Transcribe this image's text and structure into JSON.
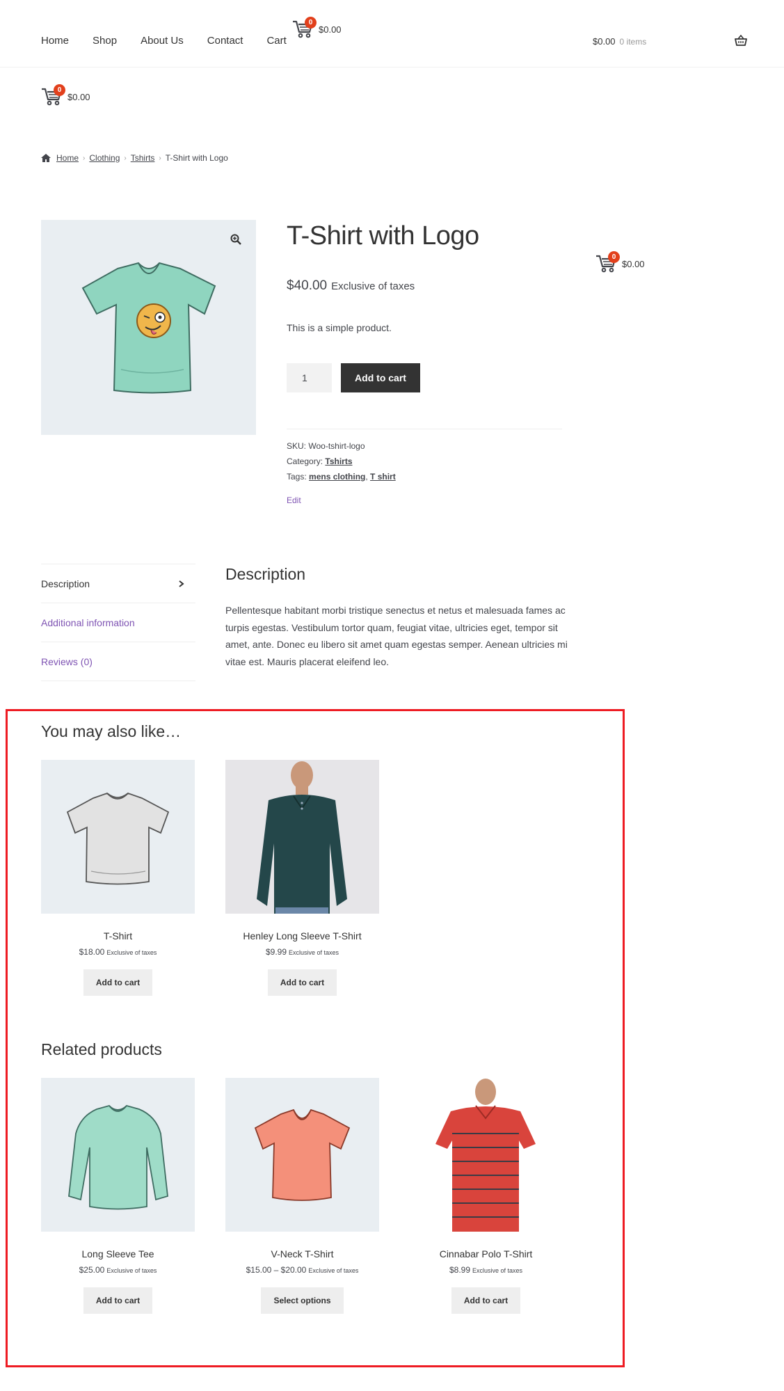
{
  "header": {
    "nav": [
      "Home",
      "Shop",
      "About Us",
      "Contact",
      "Cart"
    ],
    "mini_cart": {
      "count": "0",
      "amount": "$0.00"
    },
    "cart": {
      "amount": "$0.00",
      "items": "0 items"
    }
  },
  "second_cart": {
    "count": "0",
    "amount": "$0.00"
  },
  "breadcrumb": {
    "items": [
      "Home",
      "Clothing",
      "Tshirts"
    ],
    "current": "T-Shirt with Logo"
  },
  "product": {
    "title": "T-Shirt with Logo",
    "price": "$40.00",
    "price_suffix": "Exclusive of taxes",
    "short_description": "This is a simple product.",
    "quantity": "1",
    "add_to_cart": "Add to cart",
    "sku_label": "SKU:",
    "sku": "Woo-tshirt-logo",
    "category_label": "Category:",
    "category": "Tshirts",
    "tags_label": "Tags:",
    "tags": [
      "mens clothing",
      "T shirt"
    ],
    "edit": "Edit"
  },
  "side_cart": {
    "count": "0",
    "amount": "$0.00"
  },
  "tabs": {
    "items": [
      "Description",
      "Additional information",
      "Reviews (0)"
    ],
    "heading": "Description",
    "body": "Pellentesque habitant morbi tristique senectus et netus et malesuada fames ac turpis egestas. Vestibulum tortor quam, feugiat vitae, ultricies eget, tempor sit amet, ante. Donec eu libero sit amet quam egestas semper. Aenean ultricies mi vitae est. Mauris placerat eleifend leo."
  },
  "upsells": {
    "heading": "You may also like…",
    "products": [
      {
        "name": "T-Shirt",
        "price": "$18.00",
        "suffix": "Exclusive of taxes",
        "button": "Add to cart"
      },
      {
        "name": "Henley Long Sleeve T-Shirt",
        "price": "$9.99",
        "suffix": "Exclusive of taxes",
        "button": "Add to cart"
      }
    ]
  },
  "related": {
    "heading": "Related products",
    "products": [
      {
        "name": "Long Sleeve Tee",
        "price": "$25.00",
        "suffix": "Exclusive of taxes",
        "button": "Add to cart"
      },
      {
        "name": "V-Neck T-Shirt",
        "price": "$15.00 – $20.00",
        "suffix": "Exclusive of taxes",
        "button": "Select options"
      },
      {
        "name": "Cinnabar Polo T-Shirt",
        "price": "$8.99",
        "suffix": "Exclusive of taxes",
        "button": "Add to cart"
      }
    ]
  },
  "colors": {
    "accent_purple": "#7f54b3",
    "badge_red": "#e2401c",
    "highlight_red": "#ee1c23",
    "button_dark": "#333333",
    "button_light": "#eeeeee",
    "thumb_bg": "#e9eef2"
  }
}
